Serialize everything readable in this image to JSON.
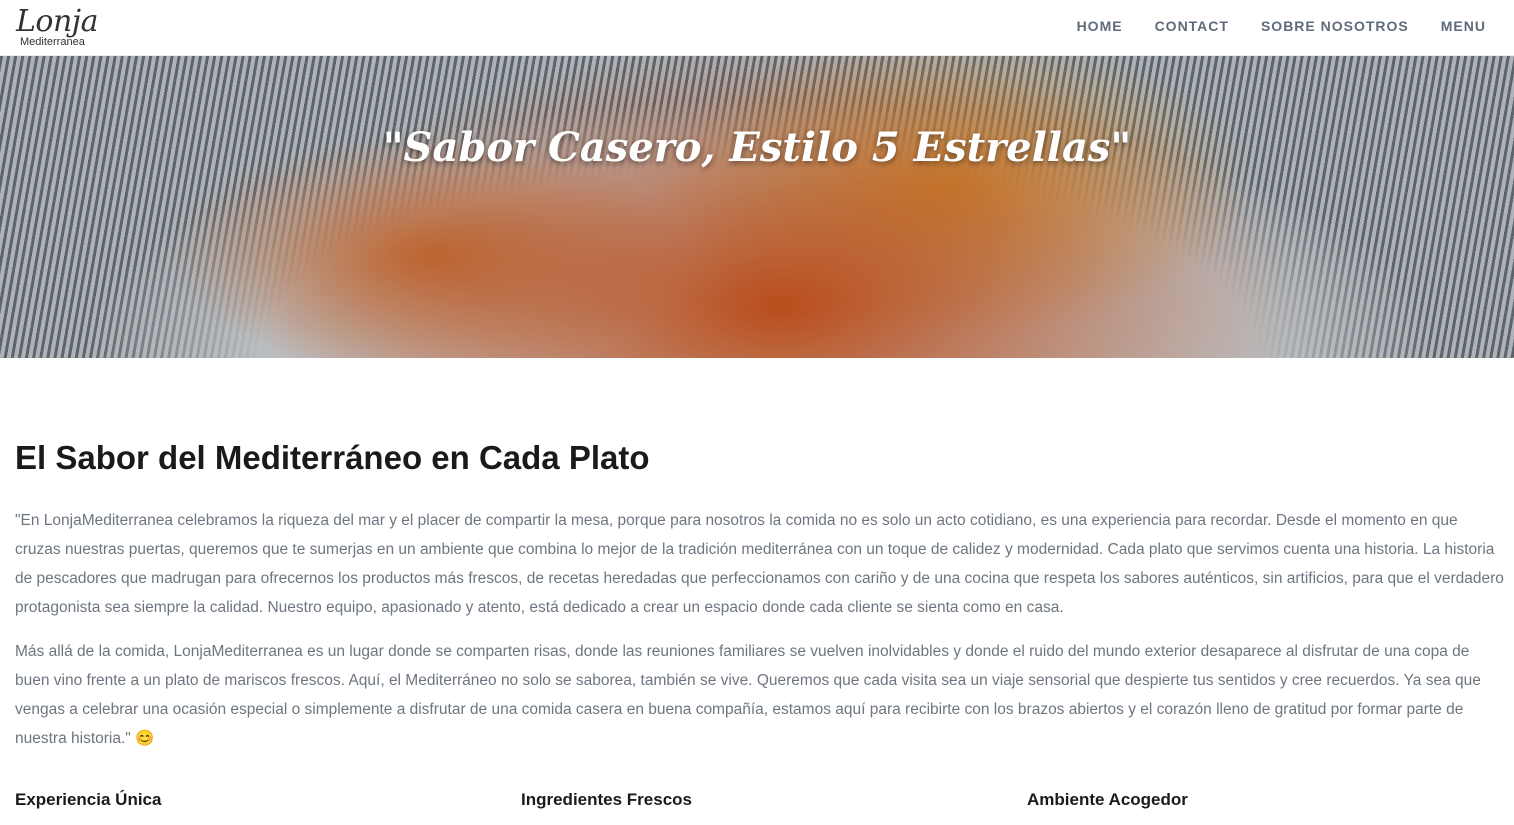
{
  "header": {
    "logo_script": "Lonja",
    "logo_sub": "Mediterranea",
    "nav": [
      "HOME",
      "CONTACT",
      "SOBRE NOSOTROS",
      "MENU"
    ]
  },
  "hero": {
    "title": "\"Sabor Casero, Estilo 5 Estrellas\""
  },
  "main": {
    "section_title": "El Sabor del Mediterráneo en Cada Plato",
    "paragraphs": [
      "\"En LonjaMediterranea celebramos la riqueza del mar y el placer de compartir la mesa, porque para nosotros la comida no es solo un acto cotidiano, es una experiencia para recordar. Desde el momento en que cruzas nuestras puertas, queremos que te sumerjas en un ambiente que combina lo mejor de la tradición mediterránea con un toque de calidez y modernidad. Cada plato que servimos cuenta una historia. La historia de pescadores que madrugan para ofrecernos los productos más frescos, de recetas heredadas que perfeccionamos con cariño y de una cocina que respeta los sabores auténticos, sin artificios, para que el verdadero protagonista sea siempre la calidad. Nuestro equipo, apasionado y atento, está dedicado a crear un espacio donde cada cliente se sienta como en casa.",
      "Más allá de la comida, LonjaMediterranea es un lugar donde se comparten risas, donde las reuniones familiares se vuelven inolvidables y donde el ruido del mundo exterior desaparece al disfrutar de una copa de buen vino frente a un plato de mariscos frescos. Aquí, el Mediterráneo no solo se saborea, también se vive. Queremos que cada visita sea un viaje sensorial que despierte tus sentidos y cree recuerdos. Ya sea que vengas a celebrar una ocasión especial o simplemente a disfrutar de una comida casera en buena compañía, estamos aquí para recibirte con los brazos abiertos y el corazón lleno de gratitud por formar parte de nuestra historia.\" 😊"
    ],
    "features": [
      "Experiencia Única",
      "Ingredientes Frescos",
      "Ambiente Acogedor"
    ]
  },
  "colors": {
    "nav_text": "#5f6b7a",
    "body_text": "#6d7680",
    "heading": "#1a1a1a"
  }
}
